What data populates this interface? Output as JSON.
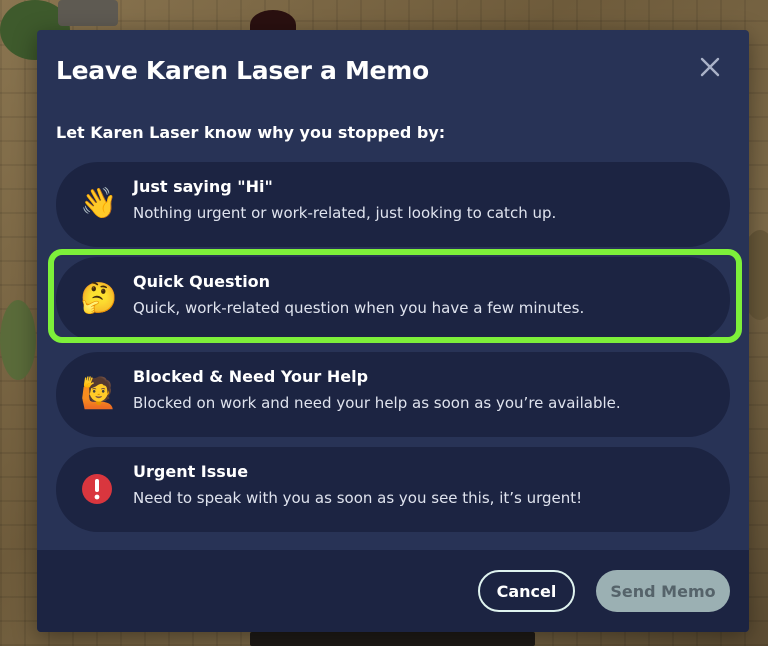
{
  "dialog": {
    "title": "Leave Karen Laser a Memo",
    "prompt": "Let Karen Laser know why you stopped by:"
  },
  "options": [
    {
      "icon": "waving-hand-icon",
      "emoji": "👋",
      "title": "Just saying \"Hi\"",
      "description": "Nothing urgent or work-related, just looking to catch up."
    },
    {
      "icon": "thinking-face-icon",
      "emoji": "🤔",
      "title": "Quick Question",
      "description": "Quick, work-related question when you have a few minutes.",
      "highlighted": true
    },
    {
      "icon": "person-raising-hand-icon",
      "emoji": "🙋",
      "title": "Blocked & Need Your Help",
      "description": "Blocked on work and need your help as soon as you’re available."
    },
    {
      "icon": "exclamation-icon",
      "emoji": "❗",
      "title": "Urgent Issue",
      "description": "Need to speak with you as soon as you see this, it’s urgent!"
    }
  ],
  "footer": {
    "cancel_label": "Cancel",
    "send_label": "Send Memo"
  },
  "colors": {
    "modal_bg": "#283356",
    "option_bg": "#1c2442",
    "highlight": "#7df03a",
    "send_disabled_bg": "#9bb0b3"
  }
}
